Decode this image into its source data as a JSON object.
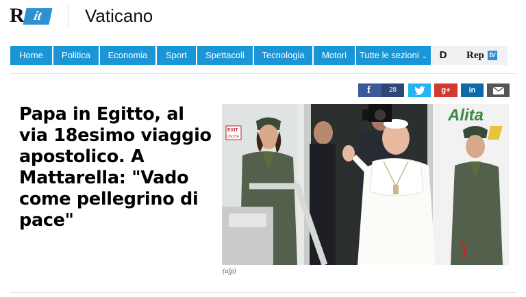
{
  "header": {
    "logo_text_r": "R",
    "logo_text_it": "it",
    "section_title": "Vaticano"
  },
  "nav": {
    "items": [
      {
        "label": "Home"
      },
      {
        "label": "Politica"
      },
      {
        "label": "Economia"
      },
      {
        "label": "Sport"
      },
      {
        "label": "Spettacoli"
      },
      {
        "label": "Tecnologia"
      },
      {
        "label": "Motori"
      },
      {
        "label": "Tutte le sezioni"
      }
    ],
    "d_label": "D",
    "rep_label": "Rep",
    "rep_tv": "tv",
    "accent_color": "#1a96d6"
  },
  "share": {
    "facebook_glyph": "f",
    "facebook_count": "28",
    "twitter_icon": "twitter-bird-icon",
    "googleplus_label": "g+",
    "linkedin_label": "in",
    "mail_icon": "envelope-icon",
    "colors": {
      "facebook": "#3b5998",
      "twitter": "#22b5f0",
      "googleplus": "#d13a2c",
      "linkedin": "#0f6aaa",
      "mail": "#555555"
    }
  },
  "article": {
    "headline": "Papa in Egitto, al via 18esimo viaggio apostolico. A Mattarella: \"Vado come pellegrino di pace\"",
    "photo_caption": "(afp)",
    "photo_sign_exit": "EXIT",
    "photo_sign_uscita": "USCITA",
    "photo_airline_text": "Alita"
  }
}
